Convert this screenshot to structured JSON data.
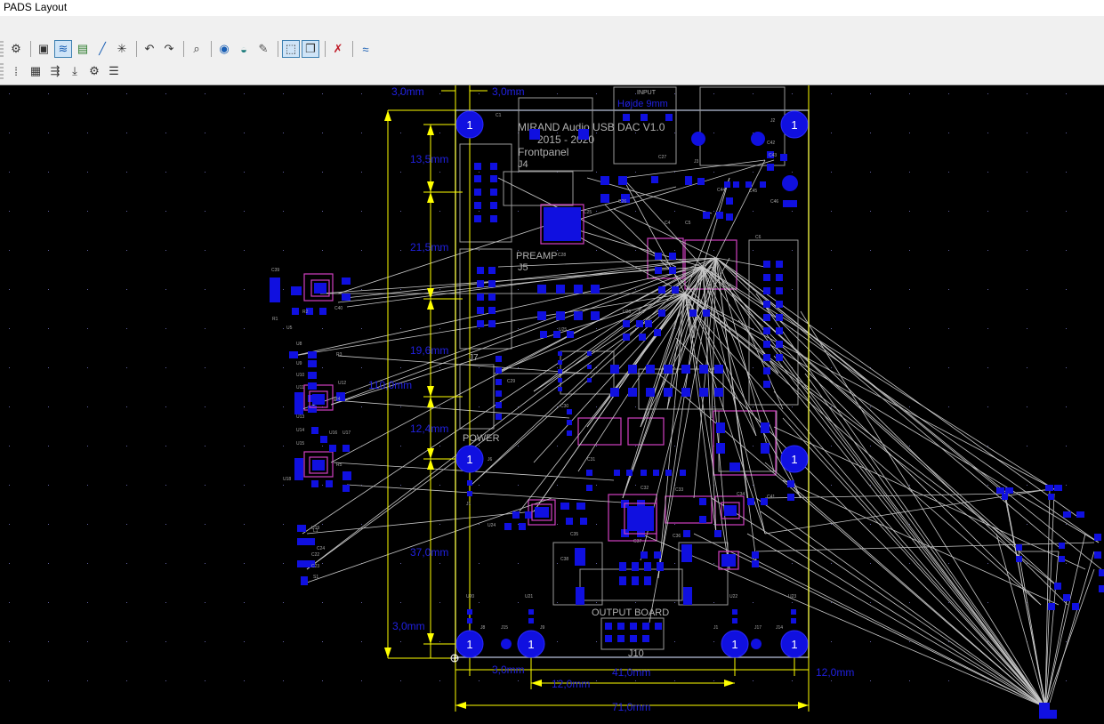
{
  "window": {
    "title": "PADS Layout"
  },
  "toolbar": {
    "row1": [
      {
        "name": "settings",
        "icon": "settings-icon"
      },
      {
        "name": "open",
        "icon": "folder-icon"
      },
      {
        "name": "route",
        "icon": "route-icon",
        "active": true
      },
      {
        "name": "pour",
        "icon": "copper-pour-icon"
      },
      {
        "name": "add-trace",
        "icon": "add-trace-icon"
      },
      {
        "name": "ratsnest",
        "icon": "ratsnest-icon"
      },
      {
        "name": "undo",
        "icon": "undo-icon"
      },
      {
        "name": "redo",
        "icon": "redo-icon"
      },
      {
        "name": "zoom",
        "icon": "zoom-icon"
      },
      {
        "name": "view-3d",
        "icon": "view-3d-icon"
      },
      {
        "name": "cam",
        "icon": "cam-icon"
      },
      {
        "name": "paint",
        "icon": "brush-icon"
      },
      {
        "name": "select-mode",
        "icon": "select-icon",
        "active": true
      },
      {
        "name": "window",
        "icon": "window-icon",
        "active": true
      },
      {
        "name": "verify",
        "icon": "verify-icon"
      },
      {
        "name": "router",
        "icon": "router-icon"
      }
    ],
    "row2": [
      {
        "name": "dots",
        "icon": "grid-dots-icon"
      },
      {
        "name": "hatch",
        "icon": "hatch-icon"
      },
      {
        "name": "align",
        "icon": "align-icon"
      },
      {
        "name": "bottom",
        "icon": "push-down-icon"
      },
      {
        "name": "gear",
        "icon": "gear-icon"
      },
      {
        "name": "list",
        "icon": "list-icon"
      }
    ]
  },
  "pcb": {
    "title_lines": [
      "MIRAND Audio USB DAC V1.0",
      "2015 - 2020",
      "Frontpanel"
    ],
    "connector_labels": {
      "input": "INPUT",
      "hojde": "Højde 9mm",
      "j4": "J4",
      "j5": "J5",
      "preamp": "PREAMP",
      "j7": "J7",
      "power": "POWER",
      "output": "OUTPUT BOARD",
      "j10": "J10"
    },
    "dimensions": {
      "top_left": "3,0mm",
      "top_mid": "3,0mm",
      "v1": "13,5mm",
      "v2": "21,5mm",
      "v3": "19,6mm",
      "v_total": "110,0mm",
      "v4": "12,4mm",
      "v5": "37,0mm",
      "v6": "3,0mm",
      "b1": "3,0mm",
      "b2": "41,0mm",
      "b3": "12,0mm",
      "b4": "12,0mm",
      "b_total": "71,0mm"
    },
    "mount_hole_label": "1",
    "ref_labels": [
      "C1",
      "J2",
      "J3",
      "J6",
      "J8",
      "J9",
      "J1",
      "J14",
      "J15",
      "J17",
      "J1",
      "U20",
      "U21",
      "U22",
      "U23",
      "U24",
      "C41",
      "C42",
      "C43",
      "C44",
      "C45",
      "C46",
      "C39",
      "C40",
      "R1",
      "R2",
      "R3",
      "R4",
      "R5",
      "L1",
      "S1",
      "U5",
      "U8",
      "U9",
      "U10",
      "U11",
      "U12",
      "U13",
      "U14",
      "U15",
      "U16",
      "U17",
      "U18",
      "U19",
      "C22",
      "C23",
      "C24",
      "C25",
      "C26",
      "C27",
      "C28",
      "C29",
      "C30",
      "C31",
      "C32",
      "C33",
      "C34",
      "C35",
      "C36",
      "C37",
      "C38",
      "U25",
      "U26",
      "C3",
      "C4",
      "C5",
      "C6",
      "C7",
      "C8",
      "C9"
    ]
  },
  "colors": {
    "background": "#000000",
    "board_outline": "#9aa3b8",
    "pads": "#1010e0",
    "silkscreen": "#a0a0a0",
    "dimension": "#ffff00",
    "dimension_text": "#2020e0",
    "ratsnest": "#c8c8c8",
    "component_outline": "#d040c0"
  }
}
